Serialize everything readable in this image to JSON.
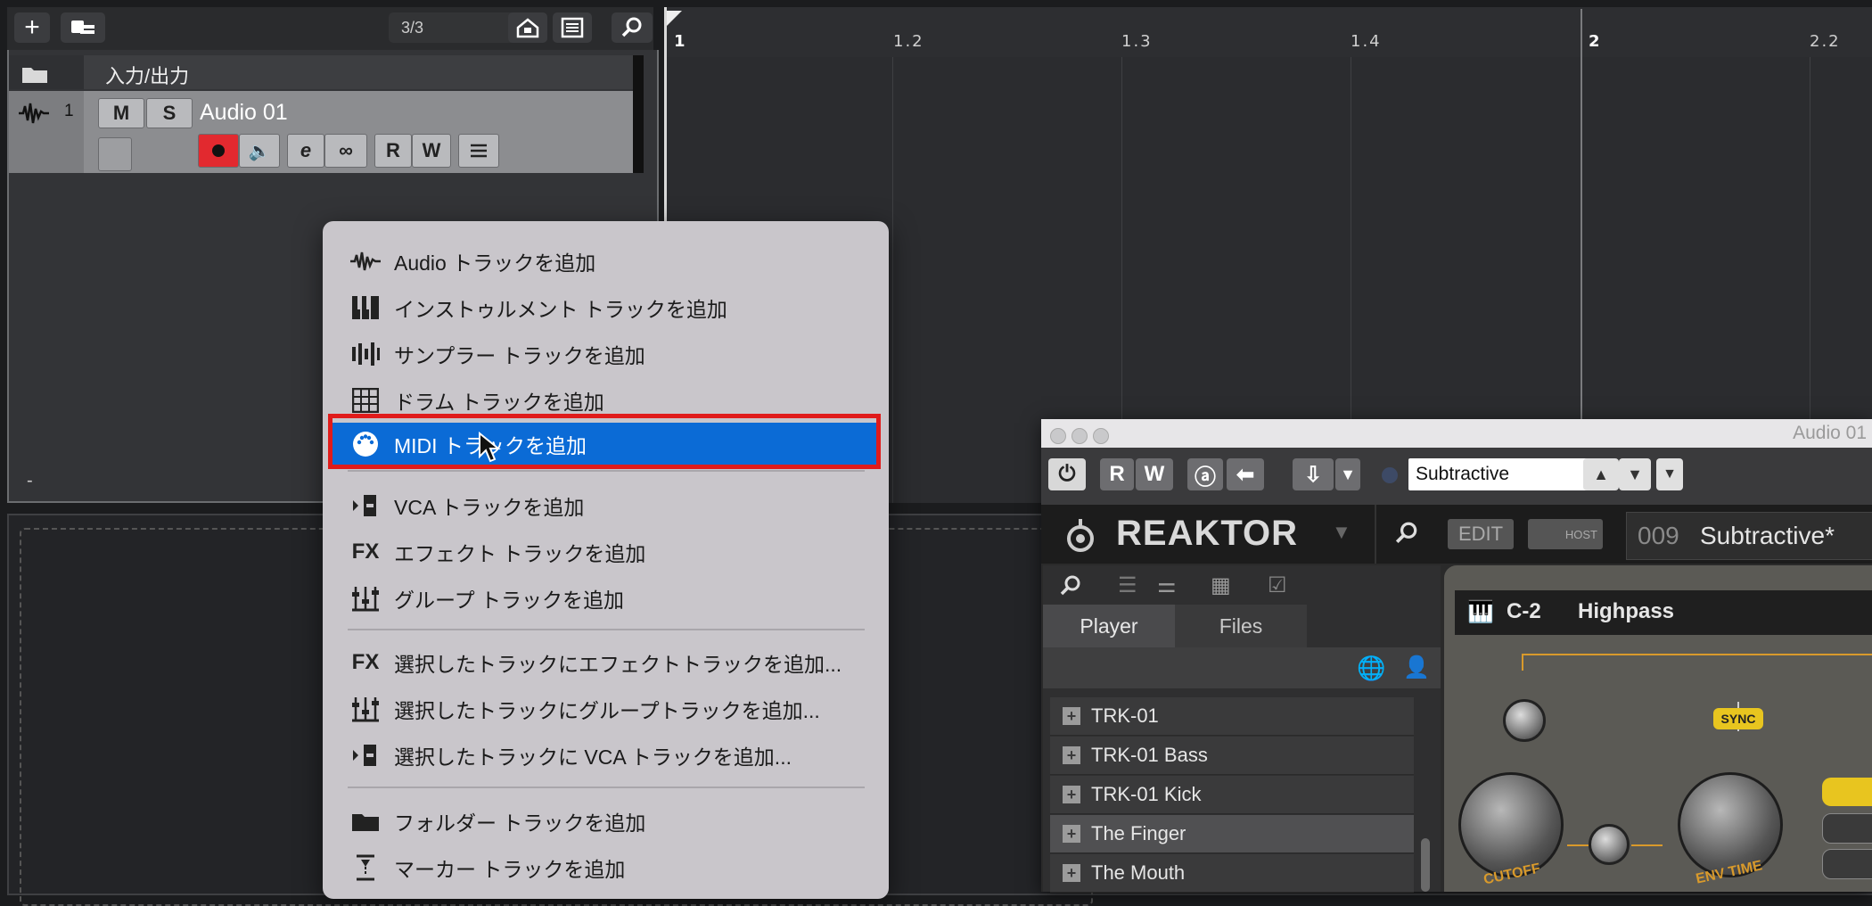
{
  "toolbar": {
    "counter": "3/3"
  },
  "tracks": {
    "folder_label": "入力/出力",
    "track_number": "1",
    "mute": "M",
    "solo": "S",
    "track_name": "Audio 01",
    "read": "R",
    "write": "W",
    "edit_label": "e"
  },
  "ruler": {
    "labels": [
      "1",
      "1.2",
      "1.3",
      "1.4",
      "2",
      "2.2"
    ]
  },
  "misc": {
    "dash": "-"
  },
  "menu": {
    "items": [
      {
        "label": "Audio トラックを追加"
      },
      {
        "label": "インストゥルメント トラックを追加"
      },
      {
        "label": "サンプラー トラックを追加"
      },
      {
        "label": "ドラム トラックを追加"
      },
      {
        "label": "MIDI トラックを追加"
      },
      {
        "label": "VCA トラックを追加"
      },
      {
        "label": "エフェクト トラックを追加"
      },
      {
        "label": "グループ トラックを追加"
      },
      {
        "label": "選択したトラックにエフェクトトラックを追加..."
      },
      {
        "label": "選択したトラックにグループトラックを追加..."
      },
      {
        "label": "選択したトラックに VCA トラックを追加..."
      },
      {
        "label": "フォルダー トラックを追加"
      },
      {
        "label": "マーカー トラックを追加"
      }
    ],
    "fx_icon_text": "FX"
  },
  "reaktor": {
    "window_title": "Audio 01",
    "read": "R",
    "write": "W",
    "preset_field": "Subtractive",
    "logo": "REAKTOR",
    "edit": "EDIT",
    "host": "HOST",
    "preset_number": "009",
    "preset_name": "Subtractive*",
    "tabs": [
      "Player",
      "Files"
    ],
    "list": [
      "TRK-01",
      "TRK-01 Bass",
      "TRK-01 Kick",
      "The Finger",
      "The Mouth"
    ],
    "note": "C-2",
    "filter_mode": "Highpass",
    "sync": "SYNC",
    "knob_labels": [
      "CUTOFF",
      "ENV TIME"
    ]
  }
}
